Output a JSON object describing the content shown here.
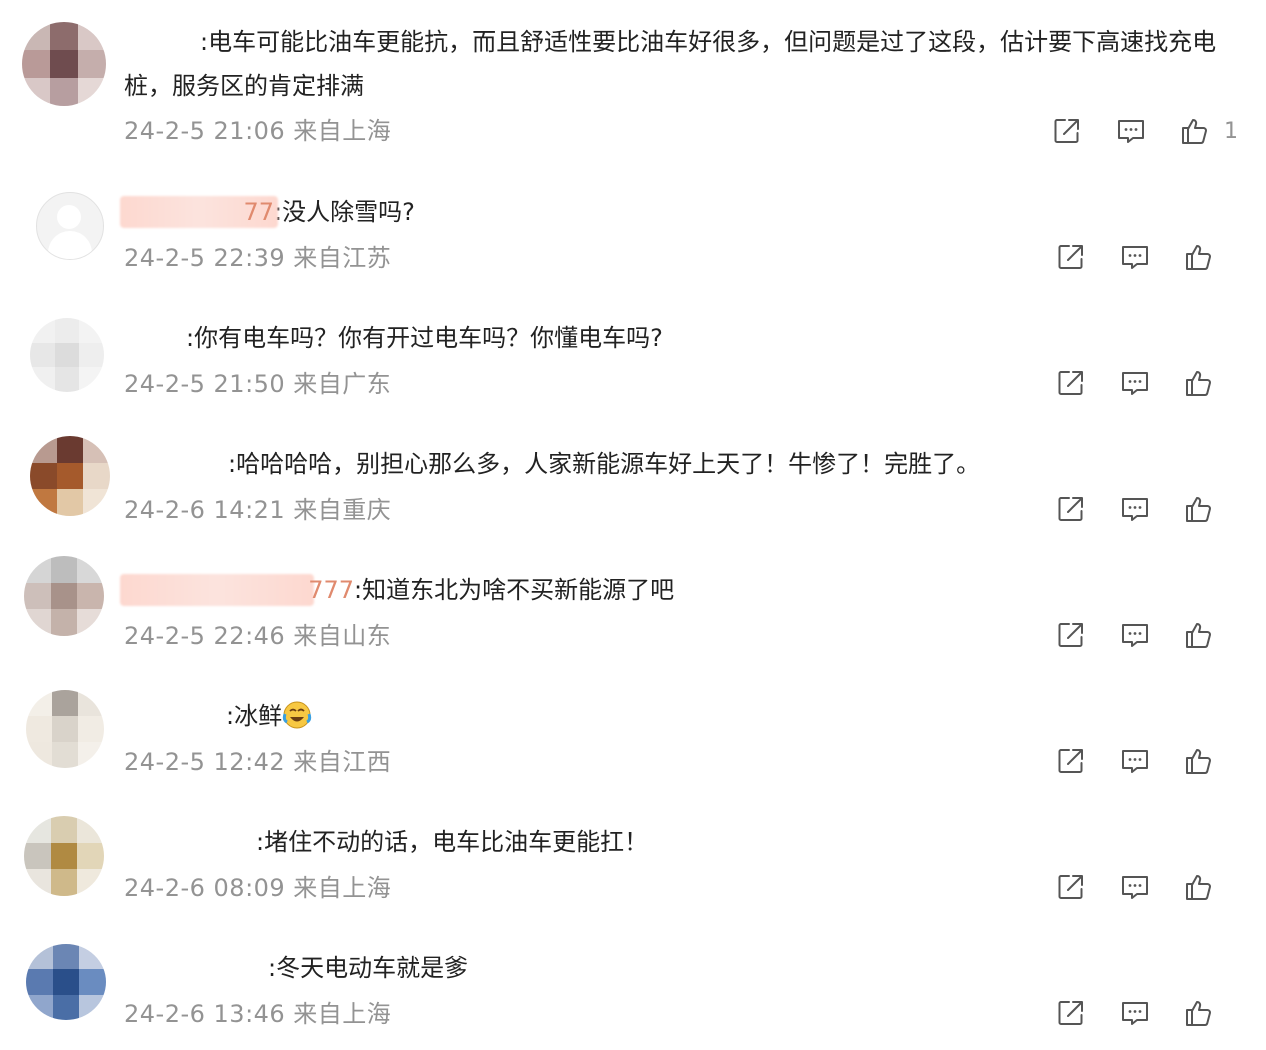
{
  "comments": [
    {
      "username_visible": "",
      "text": ":电车可能比油车更能抗，而且舒适性要比油车好很多，但问题是过了这段，估计要下高速找充电桩，服务区的肯定排满",
      "date": "24-2-5 21:06",
      "location": "来自上海",
      "likes": "1"
    },
    {
      "username_visible": "77",
      "text": ":没人除雪吗?",
      "date": "24-2-5 22:39",
      "location": "来自江苏",
      "likes": ""
    },
    {
      "username_visible": "",
      "text": ":你有电车吗？你有开过电车吗？你懂电车吗?",
      "date": "24-2-5 21:50",
      "location": "来自广东",
      "likes": ""
    },
    {
      "username_visible": "",
      "text": ":哈哈哈哈，别担心那么多，人家新能源车好上天了！牛惨了！完胜了。",
      "date": "24-2-6 14:21",
      "location": "来自重庆",
      "likes": ""
    },
    {
      "username_visible": "777",
      "text": ":知道东北为啥不买新能源了吧",
      "date": "24-2-5 22:46",
      "location": "来自山东",
      "likes": ""
    },
    {
      "username_visible": "",
      "text": ":冰鲜",
      "date": "24-2-5 12:42",
      "location": "来自江西",
      "likes": ""
    },
    {
      "username_visible": "",
      "text": ":堵住不动的话，电车比油车更能扛！",
      "date": "24-2-6 08:09",
      "location": "来自上海",
      "likes": ""
    },
    {
      "username_visible": "",
      "text": ":冬天电动车就是爹",
      "date": "24-2-6 13:46",
      "location": "来自上海",
      "likes": ""
    }
  ],
  "icons": {
    "share": "share-icon",
    "reply": "comment-icon",
    "like": "thumbs-up-icon",
    "emoji": "crying-laughing-emoji"
  },
  "colors": {
    "username": "#eb7350",
    "meta": "#939393",
    "text": "#222222",
    "icon": "#555555"
  }
}
